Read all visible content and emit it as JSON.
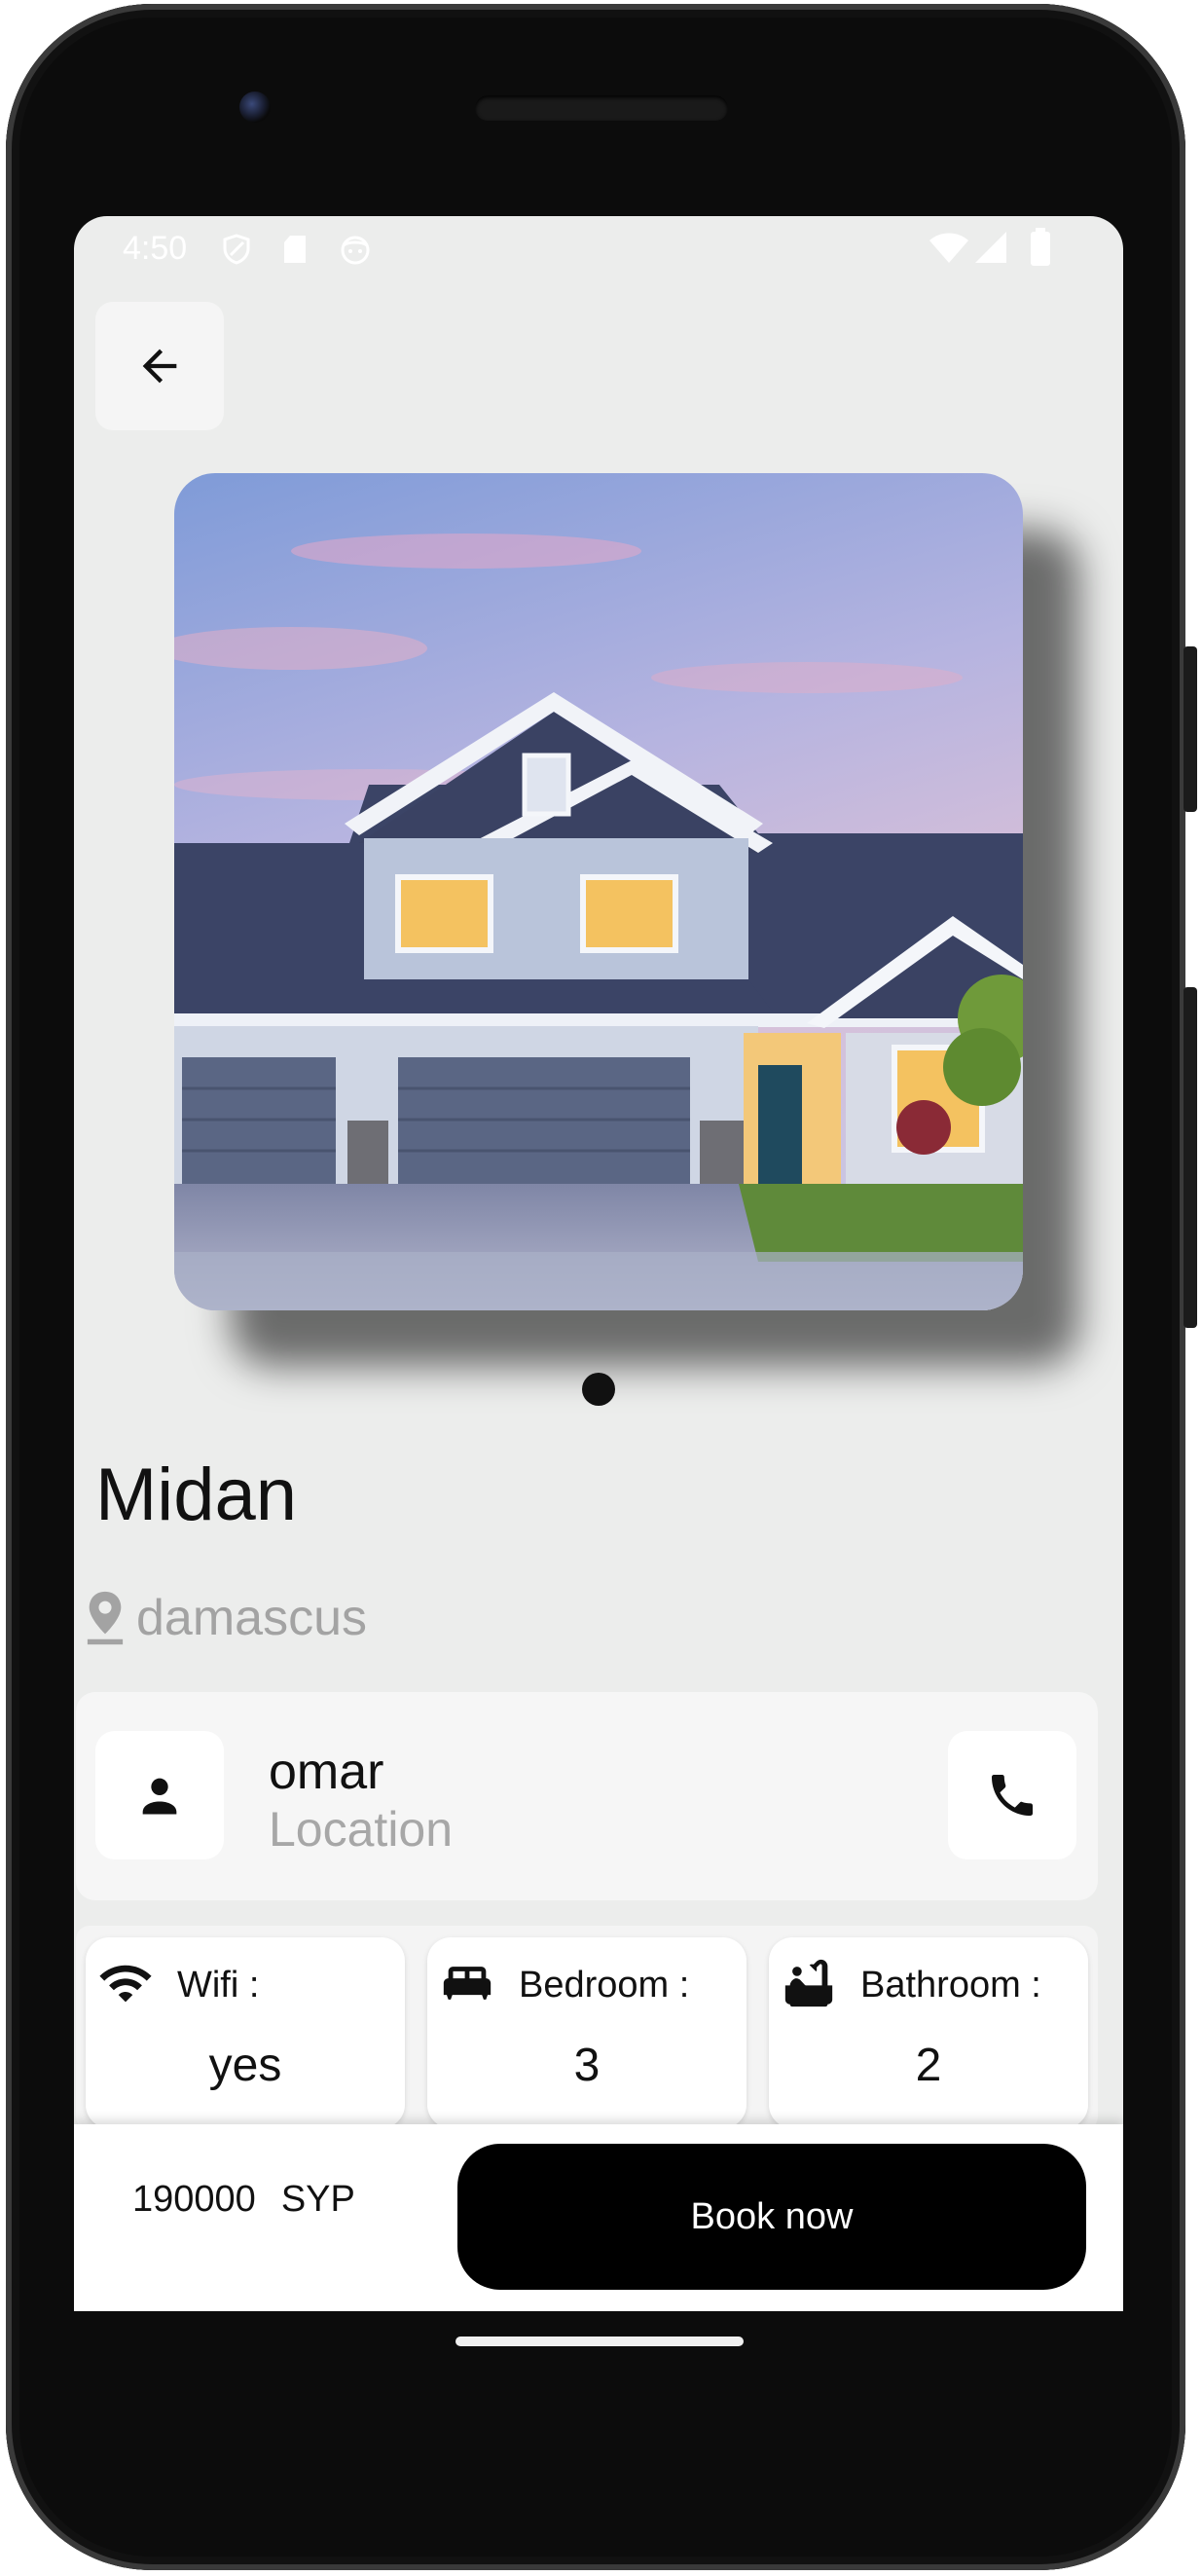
{
  "status_bar": {
    "time": "4:50"
  },
  "property": {
    "title": "Midan",
    "location": "damascus",
    "image_alt": "house photo"
  },
  "owner": {
    "name": "omar",
    "subtitle": "Location"
  },
  "features": [
    {
      "icon": "wifi-icon",
      "label": "Wifi :",
      "value": "yes"
    },
    {
      "icon": "bed-icon",
      "label": "Bedroom :",
      "value": "3"
    },
    {
      "icon": "bathtub-icon",
      "label": "Bathroom :",
      "value": "2"
    }
  ],
  "booking": {
    "price": "190000",
    "currency": "SYP",
    "book_label": "Book now"
  },
  "colors": {
    "screen_bg": "#ecedec",
    "accent": "#000000",
    "muted_text": "#a3a3a3"
  }
}
